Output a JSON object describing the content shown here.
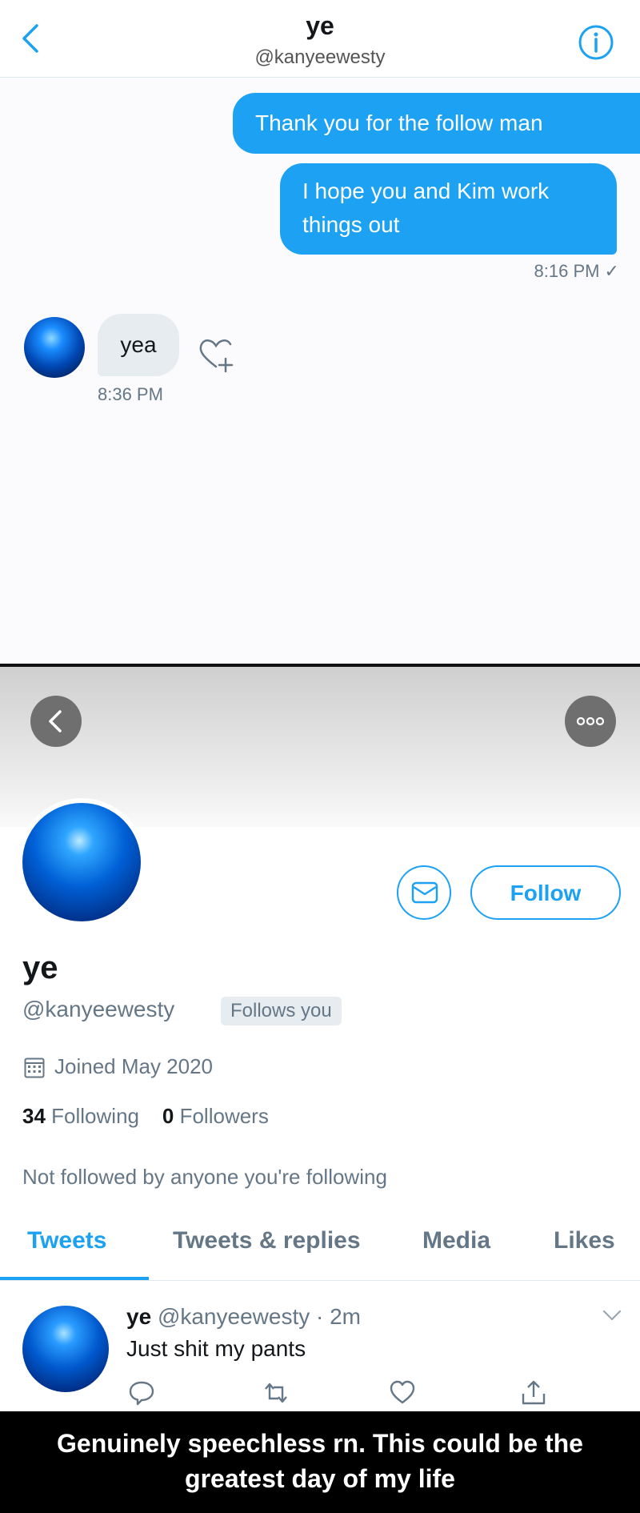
{
  "dm": {
    "title": "ye",
    "handle": "@kanyeewesty",
    "messages_sent": [
      {
        "text": "Thank you for the follow man"
      },
      {
        "text": "I hope you and Kim work things out"
      }
    ],
    "sent_time": "8:16 PM ✓",
    "received_message": "yea",
    "received_time": "8:36 PM",
    "icons": [
      "back-chevron-icon",
      "info-icon",
      "heart-add-reaction-icon"
    ]
  },
  "profile": {
    "name": "ye",
    "handle": "@kanyeewesty",
    "follows_you_badge": "Follows you",
    "follow_button": "Follow",
    "joined": "Joined May 2020",
    "following_count": "34",
    "following_label": "Following",
    "followers_count": "0",
    "followers_label": "Followers",
    "not_followed_note": "Not followed by anyone you're following",
    "tabs": [
      {
        "label": "Tweets",
        "active": true
      },
      {
        "label": "Tweets & replies",
        "active": false
      },
      {
        "label": "Media",
        "active": false
      },
      {
        "label": "Likes",
        "active": false
      }
    ],
    "tweet": {
      "name": "ye",
      "handle_time": "@kanyeewesty · 2m",
      "text": "Just shit my pants"
    }
  },
  "caption": {
    "line1": "Genuinely speechless rn. This could be the",
    "line2": "greatest day of my life"
  },
  "colors": {
    "accent": "#1da1f2",
    "secondary_text": "#657786",
    "caption_bg": "#000000"
  }
}
